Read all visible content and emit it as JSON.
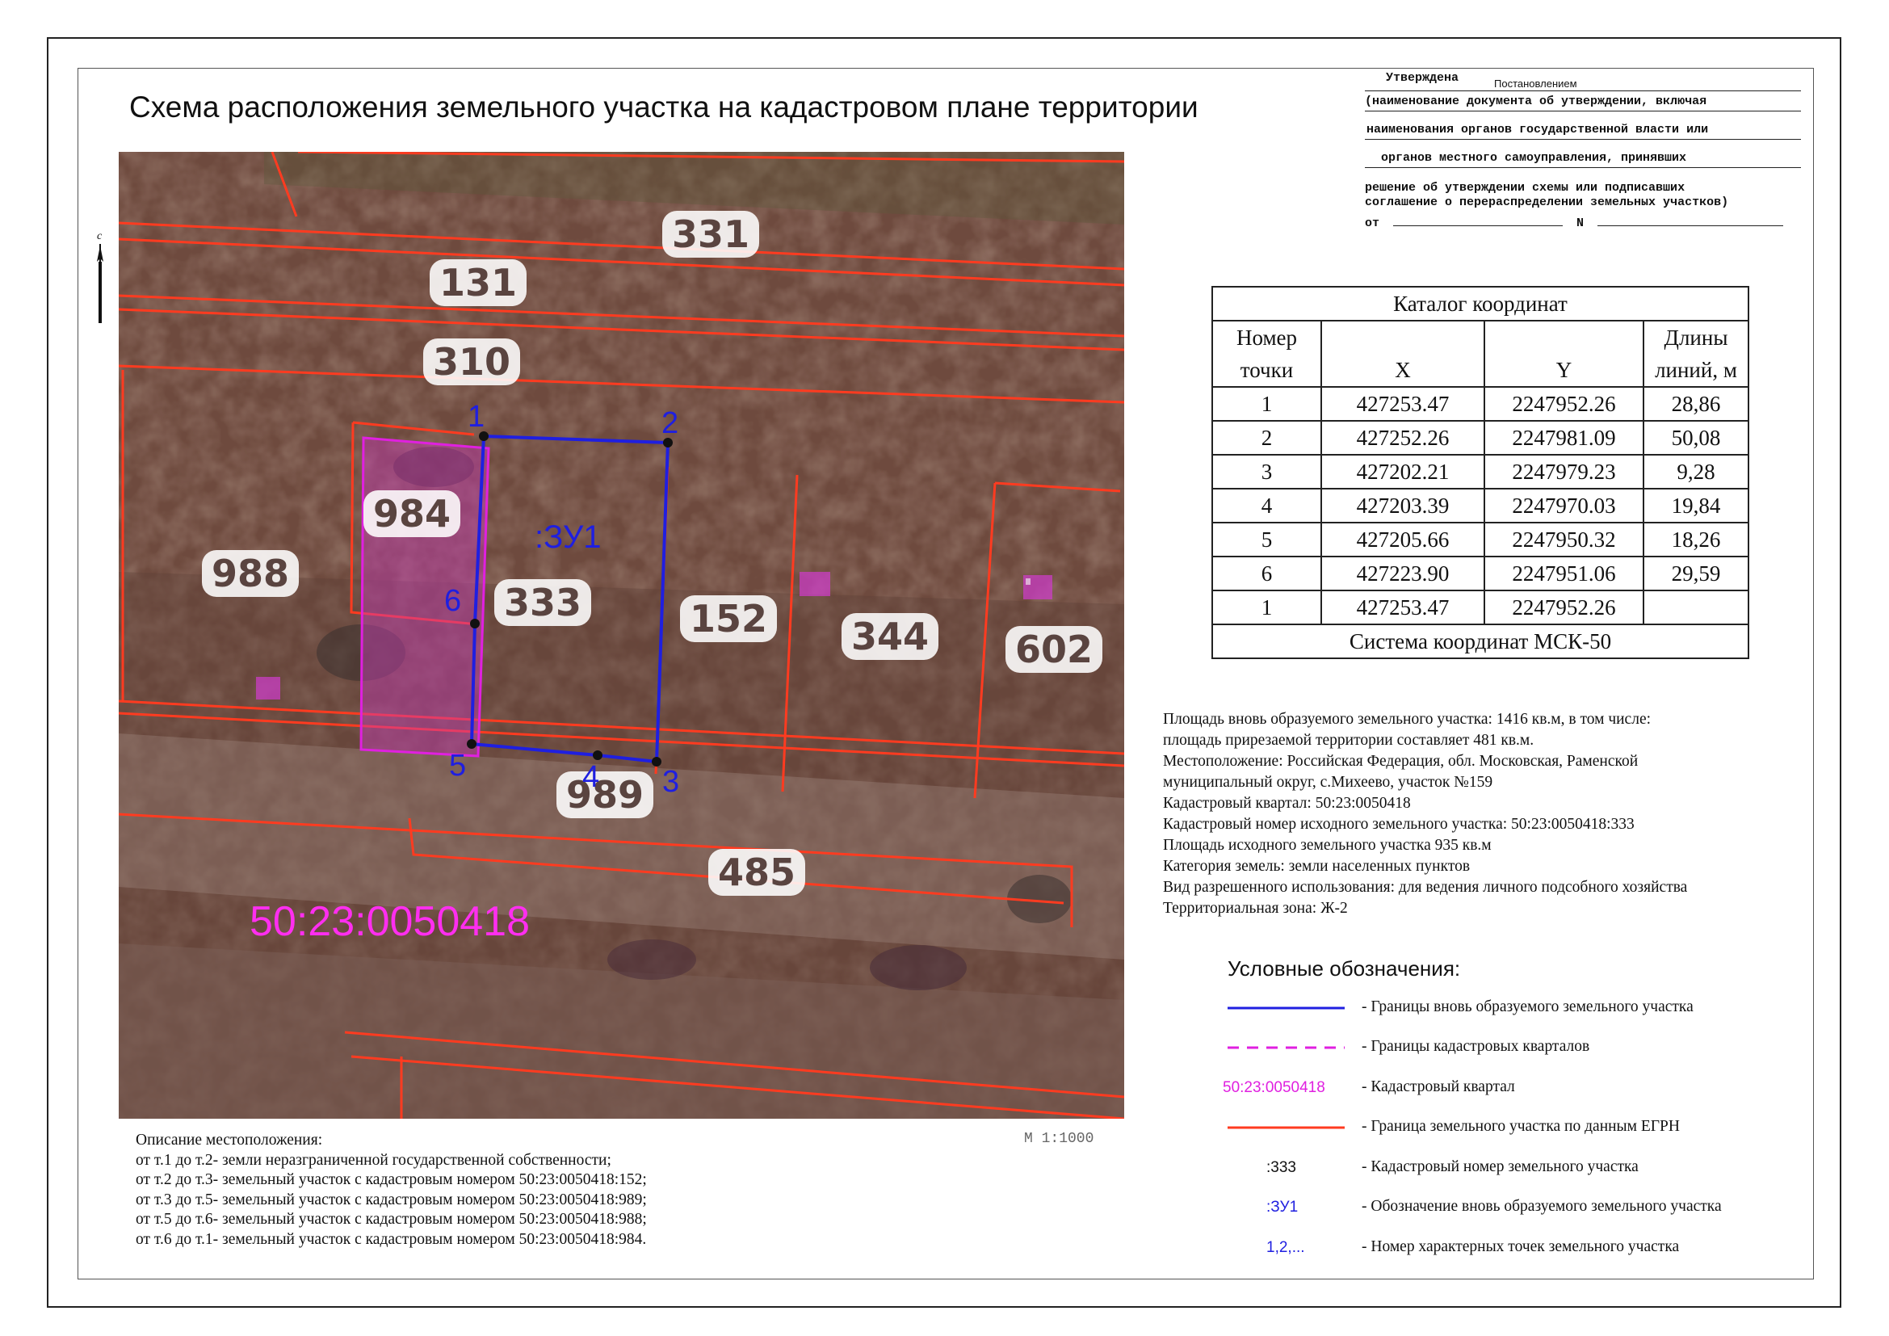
{
  "title": "Схема расположения земельного участка на кадастровом плане территории",
  "approval": {
    "line1": "Утверждена",
    "line2": "Постановлением",
    "line3": "(наименование документа об утверждении, включая",
    "line4": "наименования органов государственной власти или",
    "line5": "органов местного самоуправления, принявших",
    "line6": "решение об утверждении схемы или подписавших",
    "line7": "соглашение о перераспределении земельных участков)",
    "line8_from": "от",
    "line8_n": "N"
  },
  "map": {
    "parcel_labels": {
      "p331": "331",
      "p131": "131",
      "p310": "310",
      "p984": "984",
      "p988": "988",
      "p333": "333",
      "p152": "152",
      "p344": "344",
      "p602": "602",
      "p989": "989",
      "p485": "485"
    },
    "new_parcel_label": ":ЗУ1",
    "quarter_label": "50:23:0050418",
    "points": [
      "1",
      "2",
      "3",
      "4",
      "5",
      "6"
    ],
    "scale": "М 1:1000"
  },
  "catalog": {
    "title": "Каталог координат",
    "col_point_1": "Номер",
    "col_point_2": "точки",
    "col_x": "X",
    "col_y": "Y",
    "col_len_1": "Длины",
    "col_len_2": "линий, м",
    "rows": [
      {
        "n": "1",
        "x": "427253.47",
        "y": "2247952.26",
        "len": "28,86"
      },
      {
        "n": "2",
        "x": "427252.26",
        "y": "2247981.09",
        "len": "50,08"
      },
      {
        "n": "3",
        "x": "427202.21",
        "y": "2247979.23",
        "len": "9,28"
      },
      {
        "n": "4",
        "x": "427203.39",
        "y": "2247970.03",
        "len": "19,84"
      },
      {
        "n": "5",
        "x": "427205.66",
        "y": "2247950.32",
        "len": "18,26"
      },
      {
        "n": "6",
        "x": "427223.90",
        "y": "2247951.06",
        "len": "29,59"
      },
      {
        "n": "1",
        "x": "427253.47",
        "y": "2247952.26",
        "len": ""
      }
    ],
    "footer": "Система координат МСК-50"
  },
  "info": [
    "Площадь вновь образуемого земельного участка: 1416 кв.м, в том числе:",
    "площадь прирезаемой территории составляет 481 кв.м.",
    "Местоположение: Российская Федерация, обл. Московская, Раменской",
    "муниципальный округ, с.Михеево, участок №159",
    "Кадастровый квартал: 50:23:0050418",
    "Кадастровый номер исходного земельного участка: 50:23:0050418:333",
    "Площадь исходного земельного участка 935 кв.м",
    "Категория земель: земли населенных пунктов",
    "Вид разрешенного использования: для ведения личного подсобного хозяйства",
    "Территориальная зона: Ж-2"
  ],
  "legend": {
    "title": "Условные обозначения:",
    "items": [
      {
        "symbol": "",
        "text": "- Границы вновь образуемого земельного участка"
      },
      {
        "symbol": "",
        "text": "- Границы кадастровых кварталов"
      },
      {
        "symbol": "50:23:0050418",
        "text": "- Кадастровый квартал"
      },
      {
        "symbol": "",
        "text": "- Граница земельного участка по данным ЕГРН"
      },
      {
        "symbol": ":333",
        "text": "- Кадастровый номер земельного участка"
      },
      {
        "symbol": ":ЗУ1",
        "text": "- Обозначение вновь образуемого земельного участка"
      },
      {
        "symbol": "1,2,...",
        "text": "- Номер характерных точек земельного участка"
      }
    ]
  },
  "description": [
    "Описание местоположения:",
    "от т.1 до т.2- земли неразграниченной государственной собственности;",
    "от т.2 до т.3- земельный участок с кадастровым номером 50:23:0050418:152;",
    "от т.3 до т.5- земельный участок с кадастровым номером 50:23:0050418:989;",
    "от т.5 до т.6- земельный участок с кадастровым номером 50:23:0050418:988;",
    "от т.6 до т.1- земельный участок с кадастровым номером 50:23:0050418:984."
  ],
  "colors": {
    "new_boundary": "#1f1fe0",
    "quarter": "#e020e0",
    "egrn_boundary": "#ff3b20",
    "ground": "#6e4a3e"
  }
}
